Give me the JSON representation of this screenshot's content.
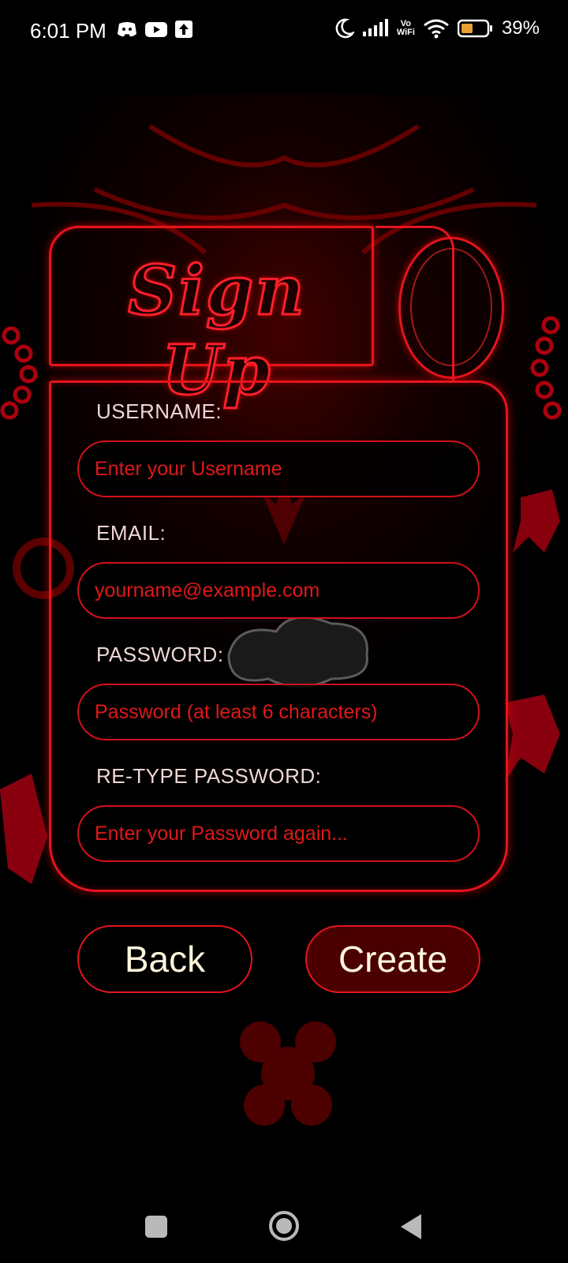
{
  "status_bar": {
    "time": "6:01 PM",
    "left_icons": [
      "discord-icon",
      "youtube-icon",
      "upload-icon"
    ],
    "right_icons": [
      "moon-icon",
      "signal-icon",
      "vowifi-icon",
      "wifi-icon",
      "battery-icon"
    ],
    "vowifi_top": "Vo",
    "vowifi_bottom": "WiFi",
    "battery": "39%"
  },
  "title": {
    "text": "Sign Up"
  },
  "form": {
    "fields": [
      {
        "label": "USERNAME:",
        "placeholder": "Enter your Username"
      },
      {
        "label": "EMAIL:",
        "placeholder": "yourname@example.com"
      },
      {
        "label": "PASSWORD:",
        "placeholder": "Password (at least 6 characters)"
      },
      {
        "label": "RE-TYPE PASSWORD:",
        "placeholder": "Enter your Password again..."
      }
    ]
  },
  "buttons": {
    "back": "Back",
    "create": "Create"
  },
  "colors": {
    "accent": "#e4141e",
    "placeholder": "#e01818",
    "label": "#f0d6d6",
    "create_bg": "#4a0000"
  }
}
